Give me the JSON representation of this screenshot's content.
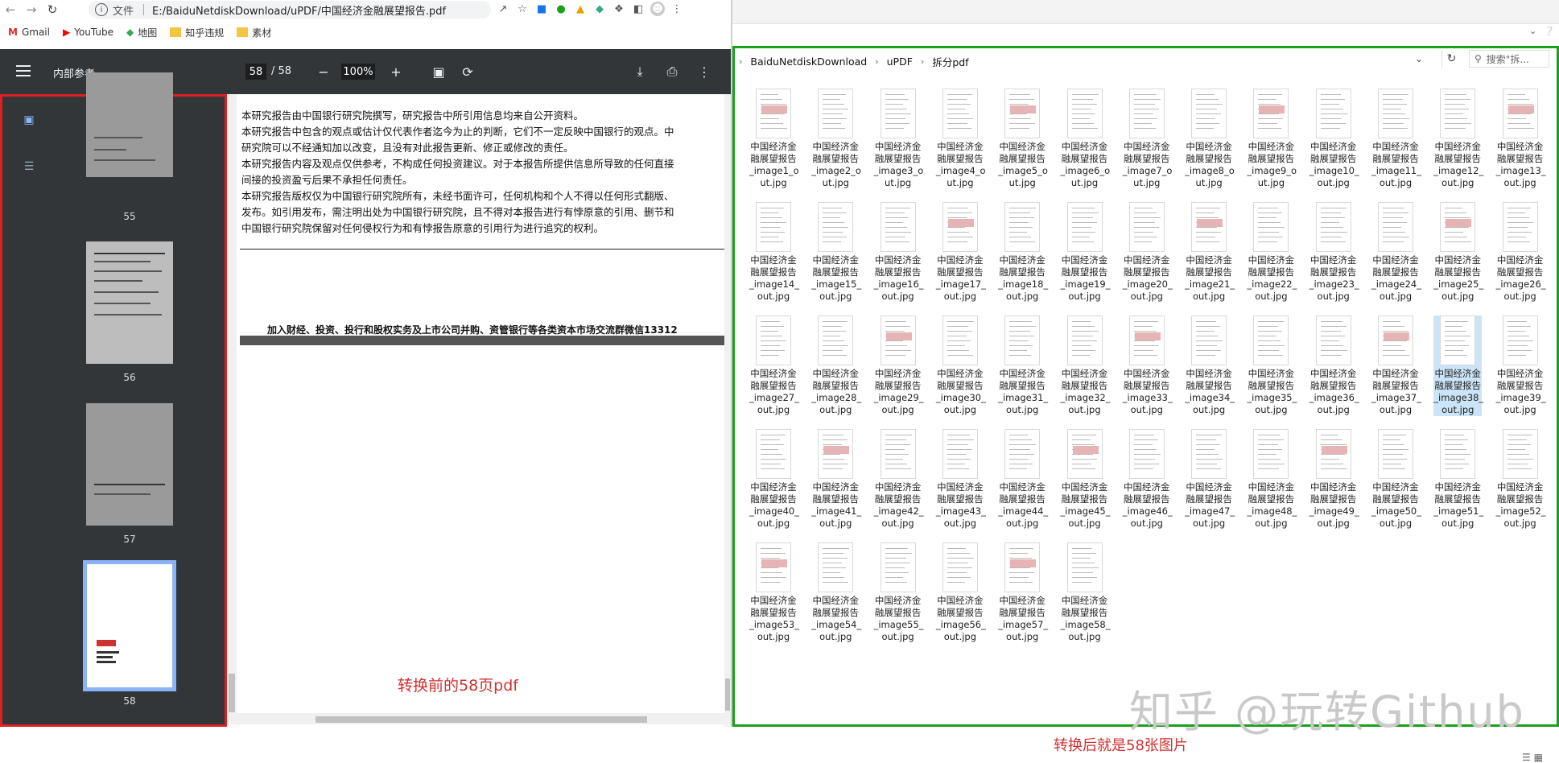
{
  "browser": {
    "url_prefix": "文件",
    "url": "E:/BaiduNetdiskDownload/uPDF/中国经济金融展望报告.pdf",
    "bookmarks": [
      "Gmail",
      "YouTube",
      "地图",
      "知乎违规",
      "素材"
    ]
  },
  "pdf": {
    "title": "内部参考",
    "page_current": "58",
    "page_total": "/ 58",
    "zoom": "100%",
    "thumbnails": [
      "55",
      "56",
      "57",
      "58"
    ],
    "lines": [
      "本研究报告由中国银行研究院撰写，研究报告中所引用信息均来自公开资料。",
      "本研究报告中包含的观点或估计仅代表作者迄今为止的判断，它们不一定反映中国银行的观点。中",
      "研究院可以不经通知加以改变，且没有对此报告更新、修正或修改的责任。",
      "本研究报告内容及观点仅供参考，不构成任何投资建议。对于本报告所提供信息所导致的任何直接",
      "间接的投资盈亏后果不承担任何责任。",
      "本研究报告版权仅为中国银行研究院所有，未经书面许可，任何机构和个人不得以任何形式翻版、",
      "发布。如引用发布，需注明出处为中国银行研究院，且不得对本报告进行有悖原意的引用、删节和",
      "中国银行研究院保留对任何侵权行为和有悖报告原意的引用行为进行追究的权利。"
    ],
    "join_line": "加入财经、投资、投行和股权实务及上市公司并购、资管银行等各类资本市场交流群微信13312",
    "caption": "转换前的58页pdf"
  },
  "explorer": {
    "breadcrumb": [
      "BaiduNetdiskDownload",
      "uPDF",
      "拆分pdf"
    ],
    "search_placeholder": "搜索\"拆...",
    "file_prefix": "中国经济金融展望报告",
    "files": [
      "中国经济金融展望报告_image1_out.jpg",
      "中国经济金融展望报告_image2_out.jpg",
      "中国经济金融展望报告_image3_out.jpg",
      "中国经济金融展望报告_image4_out.jpg",
      "中国经济金融展望报告_image5_out.jpg",
      "中国经济金融展望报告_image6_out.jpg",
      "中国经济金融展望报告_image7_out.jpg",
      "中国经济金融展望报告_image8_out.jpg",
      "中国经济金融展望报告_image9_out.jpg",
      "中国经济金融展望报告_image10_out.jpg",
      "中国经济金融展望报告_image11_out.jpg",
      "中国经济金融展望报告_image12_out.jpg",
      "中国经济金融展望报告_image13_out.jpg",
      "中国经济金融展望报告_image14_out.jpg",
      "中国经济金融展望报告_image15_out.jpg",
      "中国经济金融展望报告_image16_out.jpg",
      "中国经济金融展望报告_image17_out.jpg",
      "中国经济金融展望报告_image18_out.jpg",
      "中国经济金融展望报告_image19_out.jpg",
      "中国经济金融展望报告_image20_out.jpg",
      "中国经济金融展望报告_image21_out.jpg",
      "中国经济金融展望报告_image22_out.jpg",
      "中国经济金融展望报告_image23_out.jpg",
      "中国经济金融展望报告_image24_out.jpg",
      "中国经济金融展望报告_image25_out.jpg",
      "中国经济金融展望报告_image26_out.jpg",
      "中国经济金融展望报告_image27_out.jpg",
      "中国经济金融展望报告_image28_out.jpg",
      "中国经济金融展望报告_image29_out.jpg",
      "中国经济金融展望报告_image30_out.jpg",
      "中国经济金融展望报告_image31_out.jpg",
      "中国经济金融展望报告_image32_out.jpg",
      "中国经济金融展望报告_image33_out.jpg",
      "中国经济金融展望报告_image34_out.jpg",
      "中国经济金融展望报告_image35_out.jpg",
      "中国经济金融展望报告_image36_out.jpg",
      "中国经济金融展望报告_image37_out.jpg",
      "中国经济金融展望报告_image38_out.jpg",
      "中国经济金融展望报告_image39_out.jpg",
      "中国经济金融展望报告_image40_out.jpg",
      "中国经济金融展望报告_image41_out.jpg",
      "中国经济金融展望报告_image42_out.jpg",
      "中国经济金融展望报告_image43_out.jpg",
      "中国经济金融展望报告_image44_out.jpg",
      "中国经济金融展望报告_image45_out.jpg",
      "中国经济金融展望报告_image46_out.jpg",
      "中国经济金融展望报告_image47_out.jpg",
      "中国经济金融展望报告_image48_out.jpg",
      "中国经济金融展望报告_image49_out.jpg",
      "中国经济金融展望报告_image50_out.jpg",
      "中国经济金融展望报告_image51_out.jpg",
      "中国经济金融展望报告_image52_out.jpg",
      "中国经济金融展望报告_image53_out.jpg",
      "中国经济金融展望报告_image54_out.jpg",
      "中国经济金融展望报告_image55_out.jpg",
      "中国经济金融展望报告_image56_out.jpg",
      "中国经济金融展望报告_image57_out.jpg",
      "中国经济金融展望报告_image58_out.jpg"
    ],
    "file_lines": [
      [
        "中国经济金",
        "融展望报告",
        "_image1_o",
        "ut.jpg"
      ],
      [
        "中国经济金",
        "融展望报告",
        "_image2_o",
        "ut.jpg"
      ],
      [
        "中国经济金",
        "融展望报告",
        "_image3_o",
        "ut.jpg"
      ],
      [
        "中国经济金",
        "融展望报告",
        "_image4_o",
        "ut.jpg"
      ],
      [
        "中国经济金",
        "融展望报告",
        "_image5_o",
        "ut.jpg"
      ],
      [
        "中国经济金",
        "融展望报告",
        "_image6_o",
        "ut.jpg"
      ],
      [
        "中国经济金",
        "融展望报告",
        "_image7_o",
        "ut.jpg"
      ],
      [
        "中国经济金",
        "融展望报告",
        "_image8_o",
        "ut.jpg"
      ],
      [
        "中国经济金",
        "融展望报告",
        "_image9_o",
        "ut.jpg"
      ],
      [
        "中国经济金",
        "融展望报告",
        "_image10_",
        "out.jpg"
      ],
      [
        "中国经济金",
        "融展望报告",
        "_image11_",
        "out.jpg"
      ],
      [
        "中国经济金",
        "融展望报告",
        "_image12_",
        "out.jpg"
      ],
      [
        "中国经济金",
        "融展望报告",
        "_image13_",
        "out.jpg"
      ],
      [
        "中国经济金",
        "融展望报告",
        "_image14_",
        "out.jpg"
      ],
      [
        "中国经济金",
        "融展望报告",
        "_image15_",
        "out.jpg"
      ],
      [
        "中国经济金",
        "融展望报告",
        "_image16_",
        "out.jpg"
      ],
      [
        "中国经济金",
        "融展望报告",
        "_image17_",
        "out.jpg"
      ],
      [
        "中国经济金",
        "融展望报告",
        "_image18_",
        "out.jpg"
      ],
      [
        "中国经济金",
        "融展望报告",
        "_image19_",
        "out.jpg"
      ],
      [
        "中国经济金",
        "融展望报告",
        "_image20_",
        "out.jpg"
      ],
      [
        "中国经济金",
        "融展望报告",
        "_image21_",
        "out.jpg"
      ],
      [
        "中国经济金",
        "融展望报告",
        "_image22_",
        "out.jpg"
      ],
      [
        "中国经济金",
        "融展望报告",
        "_image23_",
        "out.jpg"
      ],
      [
        "中国经济金",
        "融展望报告",
        "_image24_",
        "out.jpg"
      ],
      [
        "中国经济金",
        "融展望报告",
        "_image25_",
        "out.jpg"
      ],
      [
        "中国经济金",
        "融展望报告",
        "_image26_",
        "out.jpg"
      ],
      [
        "中国经济金",
        "融展望报告",
        "_image27_",
        "out.jpg"
      ],
      [
        "中国经济金",
        "融展望报告",
        "_image28_",
        "out.jpg"
      ],
      [
        "中国经济金",
        "融展望报告",
        "_image29_",
        "out.jpg"
      ],
      [
        "中国经济金",
        "融展望报告",
        "_image30_",
        "out.jpg"
      ],
      [
        "中国经济金",
        "融展望报告",
        "_image31_",
        "out.jpg"
      ],
      [
        "中国经济金",
        "融展望报告",
        "_image32_",
        "out.jpg"
      ],
      [
        "中国经济金",
        "融展望报告",
        "_image33_",
        "out.jpg"
      ],
      [
        "中国经济金",
        "融展望报告",
        "_image34_",
        "out.jpg"
      ],
      [
        "中国经济金",
        "融展望报告",
        "_image35_",
        "out.jpg"
      ],
      [
        "中国经济金",
        "融展望报告",
        "_image36_",
        "out.jpg"
      ],
      [
        "中国经济金",
        "融展望报告",
        "_image37_",
        "out.jpg"
      ],
      [
        "中国经济金",
        "融展望报告",
        "_image38_",
        "out.jpg"
      ],
      [
        "中国经济金",
        "融展望报告",
        "_image39_",
        "out.jpg"
      ],
      [
        "中国经济金",
        "融展望报告",
        "_image40_",
        "out.jpg"
      ],
      [
        "中国经济金",
        "融展望报告",
        "_image41_",
        "out.jpg"
      ],
      [
        "中国经济金",
        "融展望报告",
        "_image42_",
        "out.jpg"
      ],
      [
        "中国经济金",
        "融展望报告",
        "_image43_",
        "out.jpg"
      ],
      [
        "中国经济金",
        "融展望报告",
        "_image44_",
        "out.jpg"
      ],
      [
        "中国经济金",
        "融展望报告",
        "_image45_",
        "out.jpg"
      ],
      [
        "中国经济金",
        "融展望报告",
        "_image46_",
        "out.jpg"
      ],
      [
        "中国经济金",
        "融展望报告",
        "_image47_",
        "out.jpg"
      ],
      [
        "中国经济金",
        "融展望报告",
        "_image48_",
        "out.jpg"
      ],
      [
        "中国经济金",
        "融展望报告",
        "_image49_",
        "out.jpg"
      ],
      [
        "中国经济金",
        "融展望报告",
        "_image50_",
        "out.jpg"
      ],
      [
        "中国经济金",
        "融展望报告",
        "_image51_",
        "out.jpg"
      ],
      [
        "中国经济金",
        "融展望报告",
        "_image52_",
        "out.jpg"
      ],
      [
        "中国经济金",
        "融展望报告",
        "_image53_",
        "out.jpg"
      ],
      [
        "中国经济金",
        "融展望报告",
        "_image54_",
        "out.jpg"
      ],
      [
        "中国经济金",
        "融展望报告",
        "_image55_",
        "out.jpg"
      ],
      [
        "中国经济金",
        "融展望报告",
        "_image56_",
        "out.jpg"
      ],
      [
        "中国经济金",
        "融展望报告",
        "_image57_",
        "out.jpg"
      ],
      [
        "中国经济金",
        "融展望报告",
        "_image58_",
        "out.jpg"
      ]
    ],
    "selected_index": 37,
    "caption": "转换后就是58张图片",
    "watermark": "知乎 @玩转Github"
  },
  "colors": {
    "left_frame": "#e02020",
    "right_frame": "#1aa01a",
    "caption": "#d03030",
    "thumb_highlight": "#8ab4f8"
  }
}
